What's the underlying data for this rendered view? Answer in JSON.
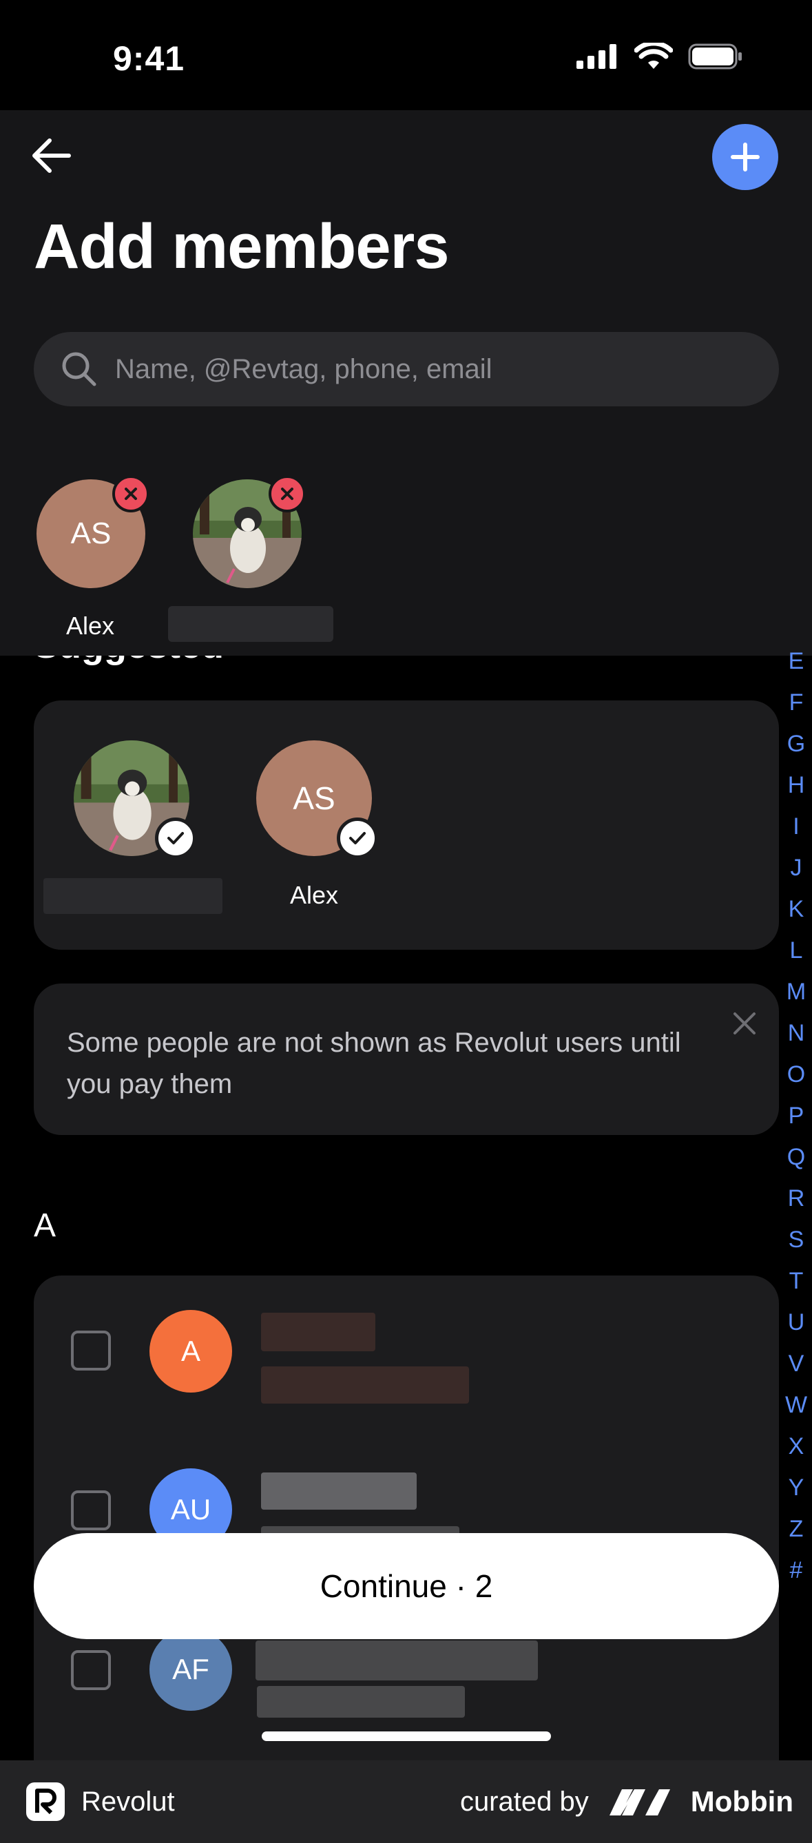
{
  "status_bar": {
    "time": "9:41"
  },
  "header": {
    "title": "Add members",
    "back_icon": "arrow-left-icon",
    "add_icon": "plus-icon",
    "accent": "#5b8cf7"
  },
  "search": {
    "placeholder": "Name, @Revtag, phone, email"
  },
  "selected": [
    {
      "initials": "AS",
      "name": "Alex",
      "color": "#b07f6a"
    },
    {
      "type": "photo",
      "name": ""
    }
  ],
  "suggested": {
    "heading": "Suggested",
    "people": [
      {
        "type": "photo",
        "name": "",
        "selected": true
      },
      {
        "initials": "AS",
        "name": "Alex",
        "color": "#b07f6a",
        "selected": true
      }
    ]
  },
  "info_banner": {
    "text": "Some people are not shown as Revolut users until you pay them"
  },
  "list": {
    "section_letter": "A",
    "rows": [
      {
        "initials": "A",
        "color": "#f4703c"
      },
      {
        "initials": "AU",
        "color": "#5b8cf7"
      },
      {
        "initials": "AF",
        "color": "#5a7fb0"
      }
    ]
  },
  "alpha_index": [
    "E",
    "F",
    "G",
    "H",
    "I",
    "J",
    "K",
    "L",
    "M",
    "N",
    "O",
    "P",
    "Q",
    "R",
    "S",
    "T",
    "U",
    "V",
    "W",
    "X",
    "Y",
    "Z",
    "#"
  ],
  "continue_button": {
    "label": "Continue · 2"
  },
  "footer": {
    "app": "Revolut",
    "curated_by": "curated by",
    "brand": "Mobbin"
  }
}
